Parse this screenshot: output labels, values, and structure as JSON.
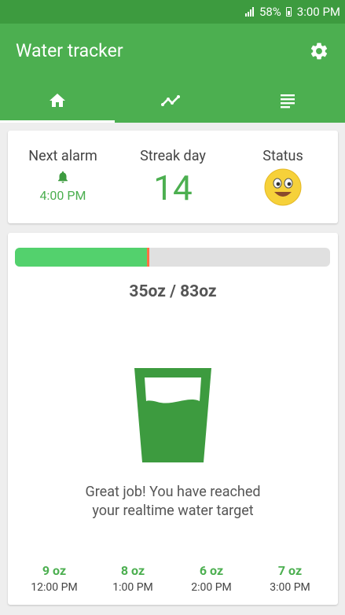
{
  "status_bar": {
    "battery": "58%",
    "time": "3:00 PM"
  },
  "app": {
    "title": "Water tracker"
  },
  "tabs": [
    {
      "name": "home",
      "icon": "home-icon",
      "active": true
    },
    {
      "name": "trend",
      "icon": "trending-icon",
      "active": false
    },
    {
      "name": "history",
      "icon": "list-icon",
      "active": false
    }
  ],
  "stats": {
    "next_alarm_label": "Next alarm",
    "next_alarm_time": "4:00 PM",
    "streak_label": "Streak day",
    "streak_value": "14",
    "status_label": "Status",
    "status_icon": "smiley-face-icon"
  },
  "progress": {
    "current_oz": 35,
    "target_oz": 83,
    "text": "35oz / 83oz",
    "fill_fraction": 0.42
  },
  "message": {
    "line1": "Great job! You have reached",
    "line2": "your realtime water target"
  },
  "logs": [
    {
      "amount": "9 oz",
      "time": "12:00 PM"
    },
    {
      "amount": "8 oz",
      "time": "1:00 PM"
    },
    {
      "amount": "6 oz",
      "time": "2:00 PM"
    },
    {
      "amount": "7 oz",
      "time": "3:00 PM"
    }
  ],
  "colors": {
    "primary": "#4caf50",
    "status_bar": "#3d9b3f",
    "progress_fill": "#53d16d",
    "progress_marker": "#ff7043",
    "glass": "#3d9b3f"
  }
}
